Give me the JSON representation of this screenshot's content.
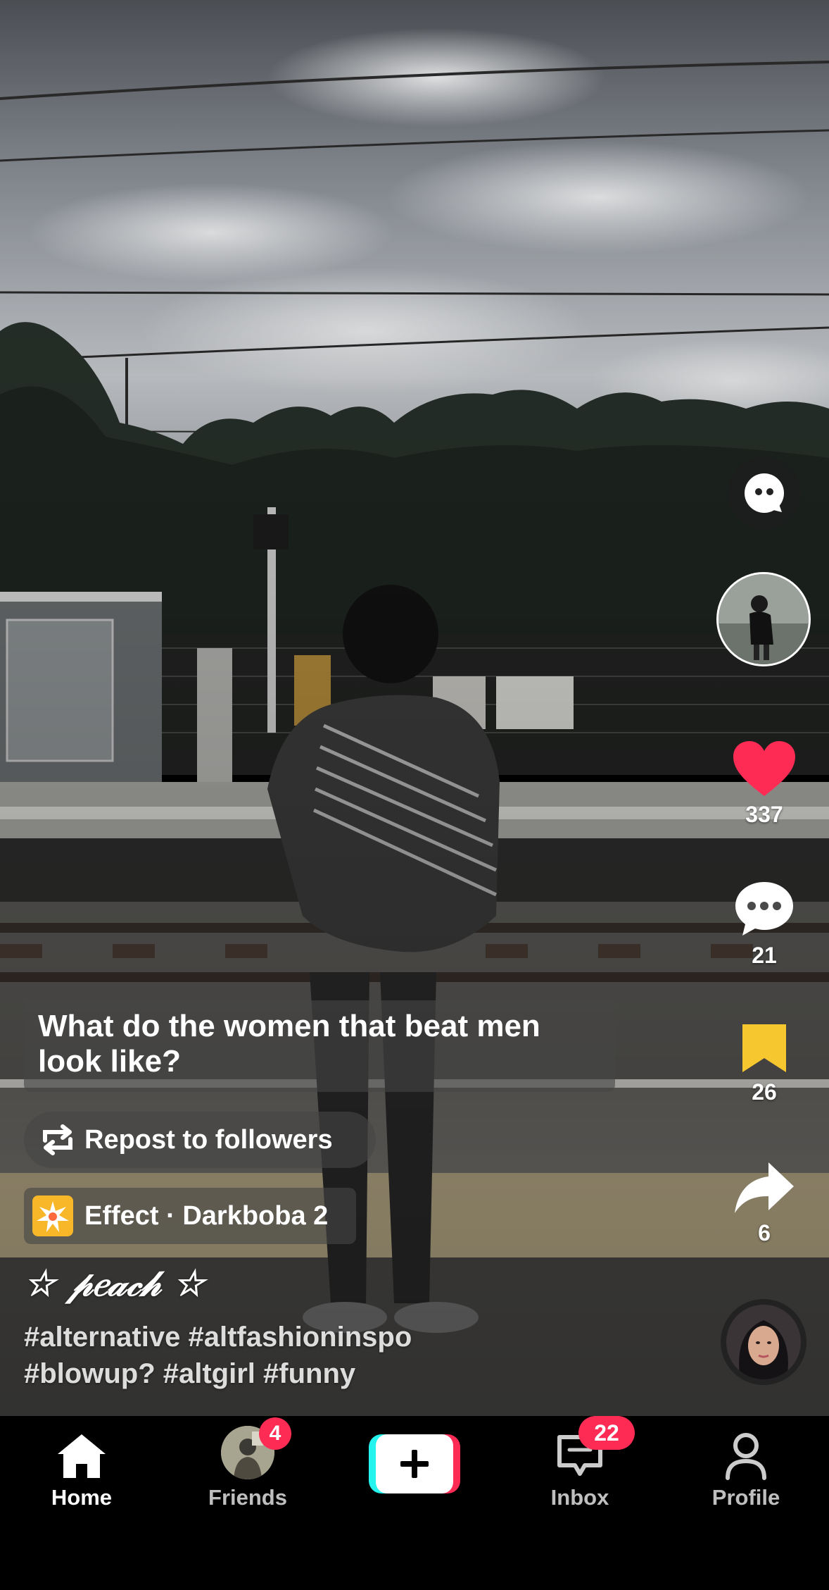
{
  "video": {
    "caption_sticker": "What do the women that beat men look like?",
    "repost_label": "Repost to followers",
    "effect_label": "Effect · Darkboba 2",
    "username": "☆ 𝓅𝑒𝒶𝒸𝒽 ☆",
    "hashtags_line1": "#alternative #altfashioninspo",
    "hashtags_line2": "#blowup? #altgirl #funny"
  },
  "actions": {
    "likes": "337",
    "comments": "21",
    "saves": "26",
    "shares": "6"
  },
  "nav": {
    "home": "Home",
    "friends": "Friends",
    "friends_badge": "4",
    "inbox": "Inbox",
    "inbox_badge": "22",
    "profile": "Profile"
  },
  "colors": {
    "like": "#fe2c55",
    "bookmark": "#f7c730",
    "create_left": "#25f4ee",
    "create_right": "#fe2c55",
    "nav_bg": "#000000"
  },
  "icons": [
    "ai-chat-icon",
    "like-heart-icon",
    "comment-icon",
    "bookmark-icon",
    "share-arrow-icon",
    "repost-icon",
    "effect-icon",
    "home-icon",
    "plus-icon",
    "inbox-icon",
    "profile-icon"
  ]
}
